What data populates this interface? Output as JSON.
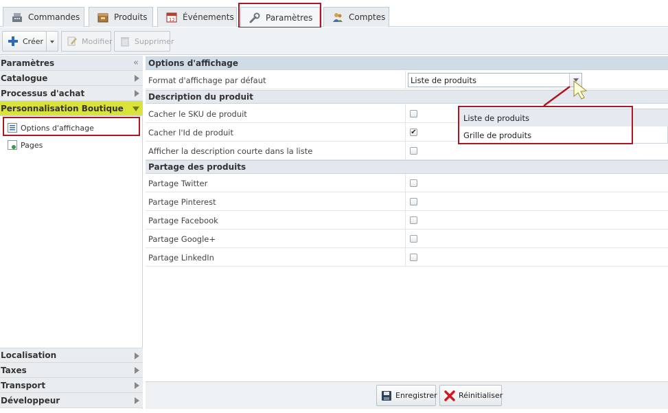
{
  "tabs": [
    {
      "label": "Commandes",
      "icon": "cash-register-icon"
    },
    {
      "label": "Produits",
      "icon": "box-icon"
    },
    {
      "label": "Événements",
      "icon": "calendar-icon"
    },
    {
      "label": "Paramètres",
      "icon": "wrench-icon",
      "active": true
    },
    {
      "label": "Comptes",
      "icon": "users-icon"
    }
  ],
  "toolbar": {
    "create_label": "Créer",
    "edit_label": "Modifier",
    "delete_label": "Supprimer"
  },
  "sidebar": {
    "title": "Paramètres",
    "sections_top": [
      {
        "label": "Catalogue"
      },
      {
        "label": "Processus d'achat"
      },
      {
        "label": "Personnalisation Boutique",
        "open": true
      }
    ],
    "items": [
      {
        "label": "Options d'affichage",
        "selected": true
      },
      {
        "label": "Pages"
      }
    ],
    "sections_bottom": [
      {
        "label": "Localisation"
      },
      {
        "label": "Taxes"
      },
      {
        "label": "Transport"
      },
      {
        "label": "Développeur"
      }
    ]
  },
  "main": {
    "title": "Options d'affichage",
    "default_format": {
      "label": "Format d'affichage par défaut",
      "value": "Liste de produits",
      "options": [
        "Liste de produits",
        "Grille de produits"
      ]
    },
    "description_section": {
      "title": "Description du produit",
      "rows": [
        {
          "label": "Cacher le SKU de produit",
          "checked": false
        },
        {
          "label": "Cacher l'Id de produit",
          "checked": true
        },
        {
          "label": "Afficher la description courte dans la liste",
          "checked": false
        }
      ]
    },
    "sharing_section": {
      "title": "Partage des produits",
      "rows": [
        {
          "label": "Partage Twitter",
          "checked": false
        },
        {
          "label": "Partage Pinterest",
          "checked": false
        },
        {
          "label": "Partage Facebook",
          "checked": false
        },
        {
          "label": "Partage Google+",
          "checked": false
        },
        {
          "label": "Partage LinkedIn",
          "checked": false
        }
      ]
    },
    "footer": {
      "save_label": "Enregistrer",
      "reset_label": "Réinitialiser"
    }
  },
  "check_mark": "✔",
  "colors": {
    "highlight_border": "#b0141e",
    "open_section": "#d9e33a",
    "section_header": "#cfdbe6"
  }
}
